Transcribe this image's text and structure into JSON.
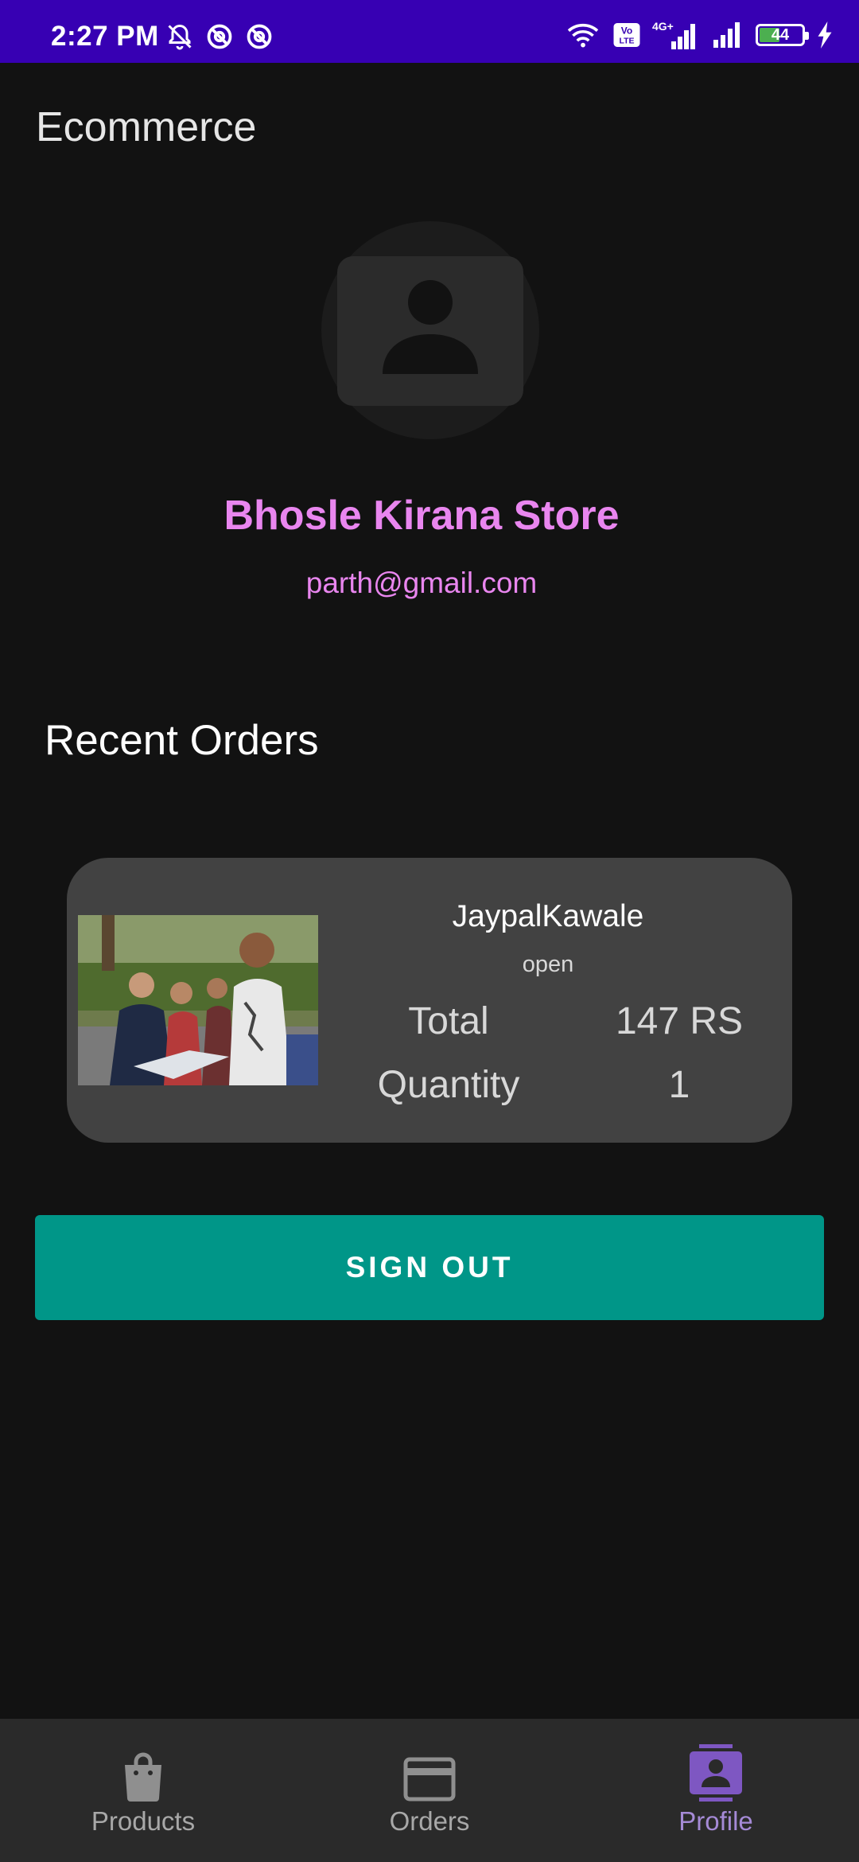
{
  "status_bar": {
    "time": "2:27 PM",
    "battery_level": "44",
    "icons": [
      "mute-icon",
      "dnd-icon",
      "dnd-icon",
      "wifi-icon",
      "volte-icon",
      "signal-4g-icon",
      "signal-icon",
      "battery-icon",
      "charging-icon"
    ]
  },
  "app": {
    "title": "Ecommerce"
  },
  "profile": {
    "store_name": "Bhosle Kirana Store",
    "email": "parth@gmail.com",
    "avatar_icon": "account-box-icon"
  },
  "recent_orders": {
    "title": "Recent Orders",
    "orders": [
      {
        "customer": "JaypalKawale",
        "status": "open",
        "total_label": "Total",
        "total_value": "147 RS",
        "quantity_label": "Quantity",
        "quantity_value": "1"
      }
    ]
  },
  "actions": {
    "sign_out": "SIGN OUT"
  },
  "bottom_nav": {
    "items": [
      {
        "label": "Products",
        "icon": "shopping-bag-icon"
      },
      {
        "label": "Orders",
        "icon": "card-icon"
      },
      {
        "label": "Profile",
        "icon": "contact-icon"
      }
    ],
    "active": "Profile"
  },
  "colors": {
    "status_bar": "#3700b3",
    "background": "#121212",
    "accent_pink": "#e986ef",
    "button_teal": "#009688",
    "card": "#424242",
    "nav_active": "#a58ad6"
  }
}
